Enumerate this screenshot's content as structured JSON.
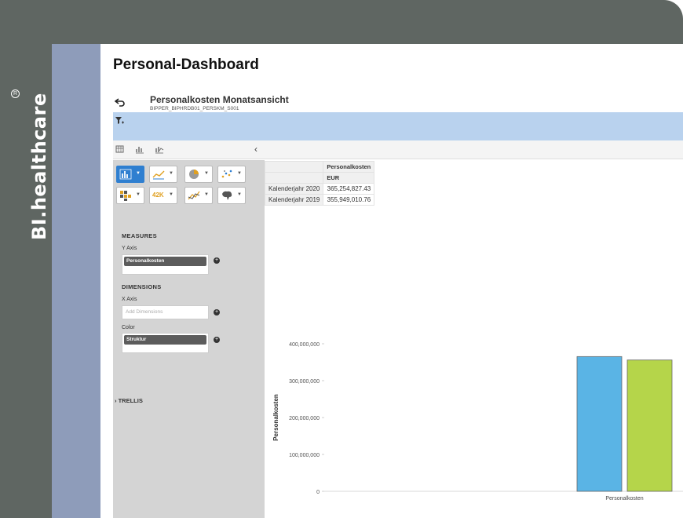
{
  "brand": {
    "name": "BI.healthcare",
    "reg_mark": "R"
  },
  "page": {
    "title": "Personal-Dashboard"
  },
  "report": {
    "title": "Personalkosten Monatsansicht",
    "subtitle": "BIPPER_BIPHRDB01_PERSKM_S001"
  },
  "icons": {
    "back": "back-arrow-icon",
    "filter": "filter-icon",
    "tool1": "table-view-icon",
    "tool2": "chart-view-icon",
    "tool3": "combined-view-icon",
    "collapse": "chevron-left-icon"
  },
  "panel": {
    "chart_type_tiles": [
      {
        "name": "bar-chart",
        "active": true
      },
      {
        "name": "line-chart",
        "active": false
      },
      {
        "name": "pie-chart",
        "active": false
      },
      {
        "name": "scatter-chart",
        "active": false
      },
      {
        "name": "heatmap-chart",
        "active": false
      },
      {
        "name": "numeric-point",
        "active": false,
        "label": "42K"
      },
      {
        "name": "trend-chart",
        "active": false
      },
      {
        "name": "geo-chart",
        "active": false
      }
    ],
    "measures_label": "MEASURES",
    "y_axis_label": "Y Axis",
    "y_axis_value": "Personalkosten",
    "dimensions_label": "DIMENSIONS",
    "x_axis_label": "X Axis",
    "x_axis_placeholder": "Add Dimensions",
    "color_label": "Color",
    "color_value": "Struktur",
    "trellis_label": "TRELLIS",
    "trellis_caret": "›"
  },
  "table": {
    "header_measure": "Personalkosten",
    "header_unit": "EUR",
    "rows": [
      {
        "label": "Kalenderjahr 2020",
        "value": "365,254,827.43"
      },
      {
        "label": "Kalenderjahr 2019",
        "value": "355,949,010.76"
      }
    ]
  },
  "chart_data": {
    "type": "bar",
    "categories": [
      "Personalkosten"
    ],
    "series": [
      {
        "name": "Kalenderjahr 2020",
        "values": [
          365254827.43
        ],
        "color": "#5ab4e5"
      },
      {
        "name": "Kalenderjahr 2019",
        "values": [
          355949010.76
        ],
        "color": "#b5d54a"
      }
    ],
    "ylabel": "Personalkosten",
    "ylim": [
      0,
      400000000
    ],
    "yticks": [
      "0",
      "100,000,000",
      "200,000,000",
      "300,000,000",
      "400,000,000"
    ],
    "grid": false
  }
}
